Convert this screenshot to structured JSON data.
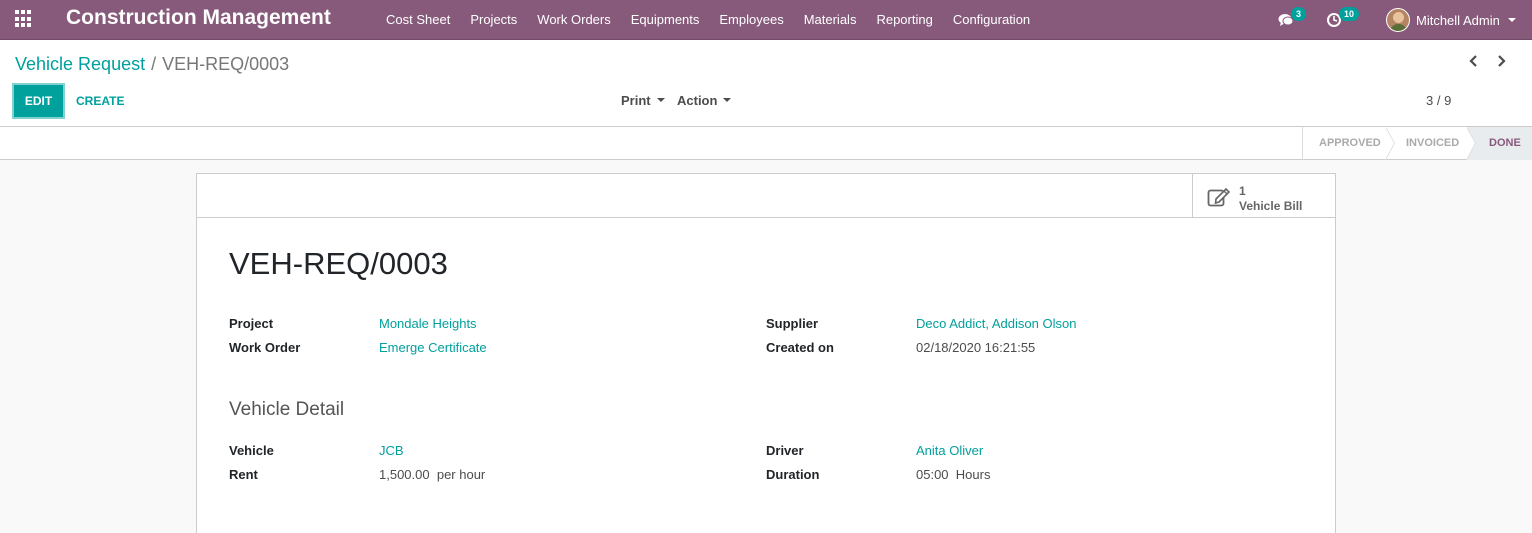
{
  "navbar": {
    "brand": "Construction Management",
    "menu": [
      "Cost Sheet",
      "Projects",
      "Work Orders",
      "Equipments",
      "Employees",
      "Materials",
      "Reporting",
      "Configuration"
    ],
    "chat_count": "3",
    "activity_count": "10",
    "user_name": "Mitchell Admin"
  },
  "breadcrumb": {
    "parent": "Vehicle Request",
    "separator": "/",
    "current": "VEH-REQ/0003"
  },
  "buttons": {
    "edit": "EDIT",
    "create": "CREATE",
    "print": "Print",
    "action": "Action"
  },
  "pager": {
    "value": "3 / 9"
  },
  "status": {
    "stages": [
      "APPROVED",
      "INVOICED",
      "DONE"
    ],
    "current": "DONE"
  },
  "smart_button": {
    "value": "1",
    "label": "Vehicle Bill"
  },
  "form": {
    "title": "VEH-REQ/0003",
    "project_label": "Project",
    "project": "Mondale Heights",
    "work_order_label": "Work Order",
    "work_order": "Emerge Certificate",
    "supplier_label": "Supplier",
    "supplier": "Deco Addict, Addison Olson",
    "created_on_label": "Created on",
    "created_on": "02/18/2020 16:21:55",
    "section_title": "Vehicle Detail",
    "vehicle_label": "Vehicle",
    "vehicle": "JCB",
    "rent_label": "Rent",
    "rent": "1,500.00",
    "rent_unit": "per hour",
    "driver_label": "Driver",
    "driver": "Anita Oliver",
    "duration_label": "Duration",
    "duration": "05:00",
    "duration_unit": "Hours"
  },
  "colors": {
    "navbar": "#875a7b",
    "accent": "#00a09d",
    "current_stage": "#875a7b"
  }
}
